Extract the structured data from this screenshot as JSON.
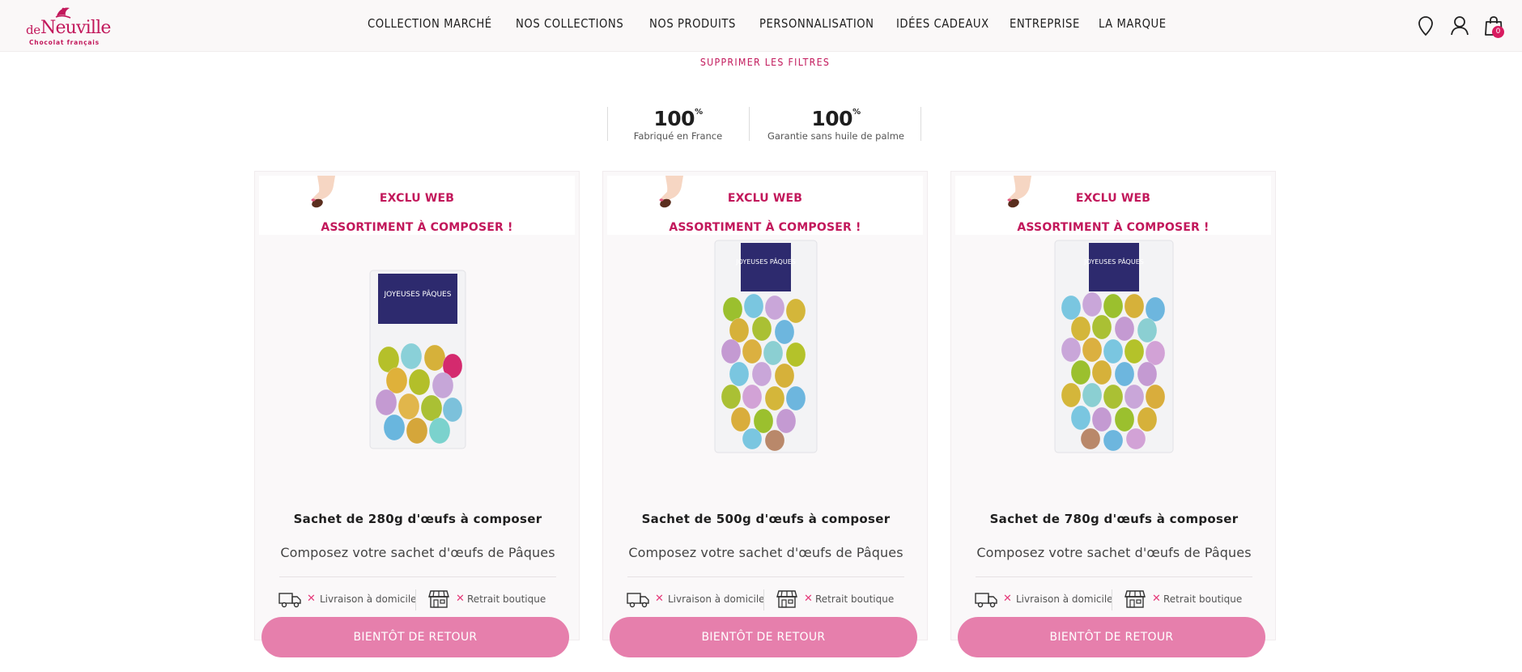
{
  "brand": {
    "name": "deNeuville",
    "tagline": "Chocolat français"
  },
  "nav": {
    "items": [
      "COLLECTION MARCHÉ",
      "NOS COLLECTIONS",
      "NOS PRODUITS",
      "PERSONNALISATION",
      "IDÉES CADEAUX",
      "ENTREPRISE",
      "LA MARQUE"
    ]
  },
  "header_icons": [
    "location-pin-icon",
    "user-icon",
    "shopping-bag-icon"
  ],
  "cart": {
    "count": "0"
  },
  "filters": {
    "clear_label": "SUPPRIMER LES FILTRES"
  },
  "badges": [
    {
      "value": "100",
      "unit": "%",
      "caption": "Fabriqué en France"
    },
    {
      "value": "100",
      "unit": "%",
      "caption": "Garantie sans huile de palme"
    }
  ],
  "products": [
    {
      "banner_line1": "EXCLU WEB",
      "banner_line2": "ASSORTIMENT À COMPOSER !",
      "title": "Sachet de 280g d'œufs à composer",
      "description": "Composez votre sachet d'œufs de Pâques",
      "delivery_label": "Livraison à domicile",
      "pickup_label": "Retrait boutique",
      "cta": "BIENTÔT DE RETOUR",
      "label_text": "JOYEUSES PÂQUES"
    },
    {
      "banner_line1": "EXCLU WEB",
      "banner_line2": "ASSORTIMENT À COMPOSER !",
      "title": "Sachet de 500g d'œufs à composer",
      "description": "Composez votre sachet d'œufs de Pâques",
      "delivery_label": "Livraison à domicile",
      "pickup_label": "Retrait boutique",
      "cta": "BIENTÔT DE RETOUR",
      "label_text": "JOYEUSES PÂQUES"
    },
    {
      "banner_line1": "EXCLU WEB",
      "banner_line2": "ASSORTIMENT À COMPOSER !",
      "title": "Sachet de 780g d'œufs à composer",
      "description": "Composez votre sachet d'œufs de Pâques",
      "delivery_label": "Livraison à domicile",
      "pickup_label": "Retrait boutique",
      "cta": "BIENTÔT DE RETOUR",
      "label_text": "JOYEUSES PÂQUES"
    }
  ],
  "colors": {
    "brand": "#c2185b",
    "cta": "#e67fac",
    "cross": "#e53979"
  }
}
